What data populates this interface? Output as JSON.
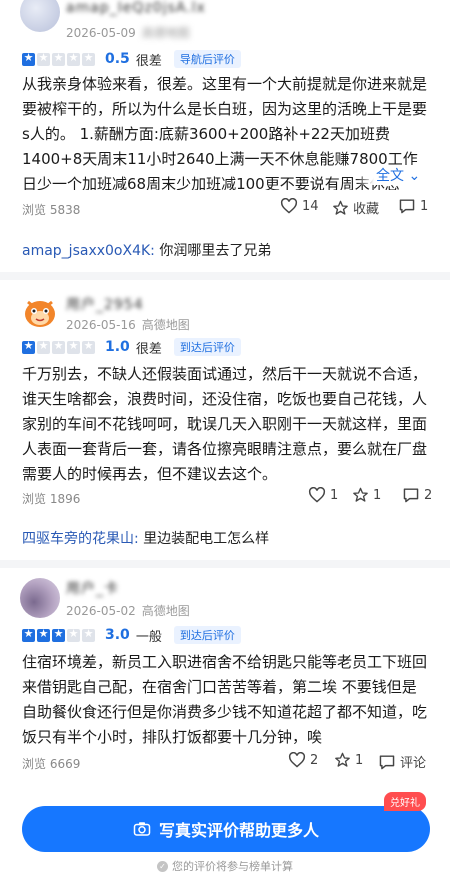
{
  "reviews": [
    {
      "user": "amap_IeQz0jsA.lx",
      "date": "2026-05-09",
      "source": "高德地图",
      "stars": 1,
      "score": "0.5",
      "level": "很差",
      "tag": "导航后评价",
      "text": "从我亲身体验来看，很差。这里有一个大前提就是你进来就是要被榨干的，所以为什么是长白班，因为这里的活晚上干是要s人的。 1.薪酬方面:底薪3600+200路补+22天加班费1400+8天周末11小时2640上满一天不休息能赚7800工作日少一个加班减68周末少加班减100更不要说有周末休息",
      "more": "全文",
      "views_label": "浏览 5838",
      "likes": "14",
      "collect": "收藏",
      "comments": "1",
      "reply": {
        "who": "amap_jsaxx0oX4K:",
        "msg": "你润哪里去了兄弟"
      }
    },
    {
      "user": "用户_2954",
      "date": "2026-05-16",
      "source": "高德地图",
      "stars": 1,
      "score": "1.0",
      "level": "很差",
      "tag": "到达后评价",
      "text": "千万别去，不缺人还假装面试通过，然后干一天就说不合适，谁天生啥都会，浪费时间，还没住宿，吃饭也要自己花钱，人家别的车间不花钱呵呵，耽误几天入职刚干一天就这样，里面人表面一套背后一套，请各位擦亮眼睛注意点，要么就在厂盘需要人的时候再去，但不建议去这个。",
      "views_label": "浏览 1896",
      "likes": "1",
      "collect": "1",
      "comments": "2",
      "reply": {
        "who": "四驱车旁的花果山:",
        "msg": "里边装配电工怎么样"
      }
    },
    {
      "user": "用户_卡",
      "date": "2026-05-02",
      "source": "高德地图",
      "stars": 3,
      "score": "3.0",
      "level": "一般",
      "tag": "到达后评价",
      "text": "住宿环境差，新员工入职进宿舍不给钥匙只能等老员工下班回来借钥匙自己配，在宿舍门口苦苦等着，第二埃 不要钱但是自助餐伙食还行但是你消费多少钱不知道花超了都不知道，吃饭只有半个小时，排队打饭都要十几分钟，唉",
      "views_label": "浏览 6669",
      "likes": "2",
      "collect": "1",
      "comments": "评论"
    }
  ],
  "cta": {
    "label": "写真实评价帮助更多人",
    "badge": "兑好礼",
    "note": "您的评价将参与榜单计算"
  },
  "colors": {
    "accent": "#1677ff",
    "star_on": "#1f6fe0",
    "star_off": "#dfe3ea",
    "badge": "#ff4d4f"
  }
}
